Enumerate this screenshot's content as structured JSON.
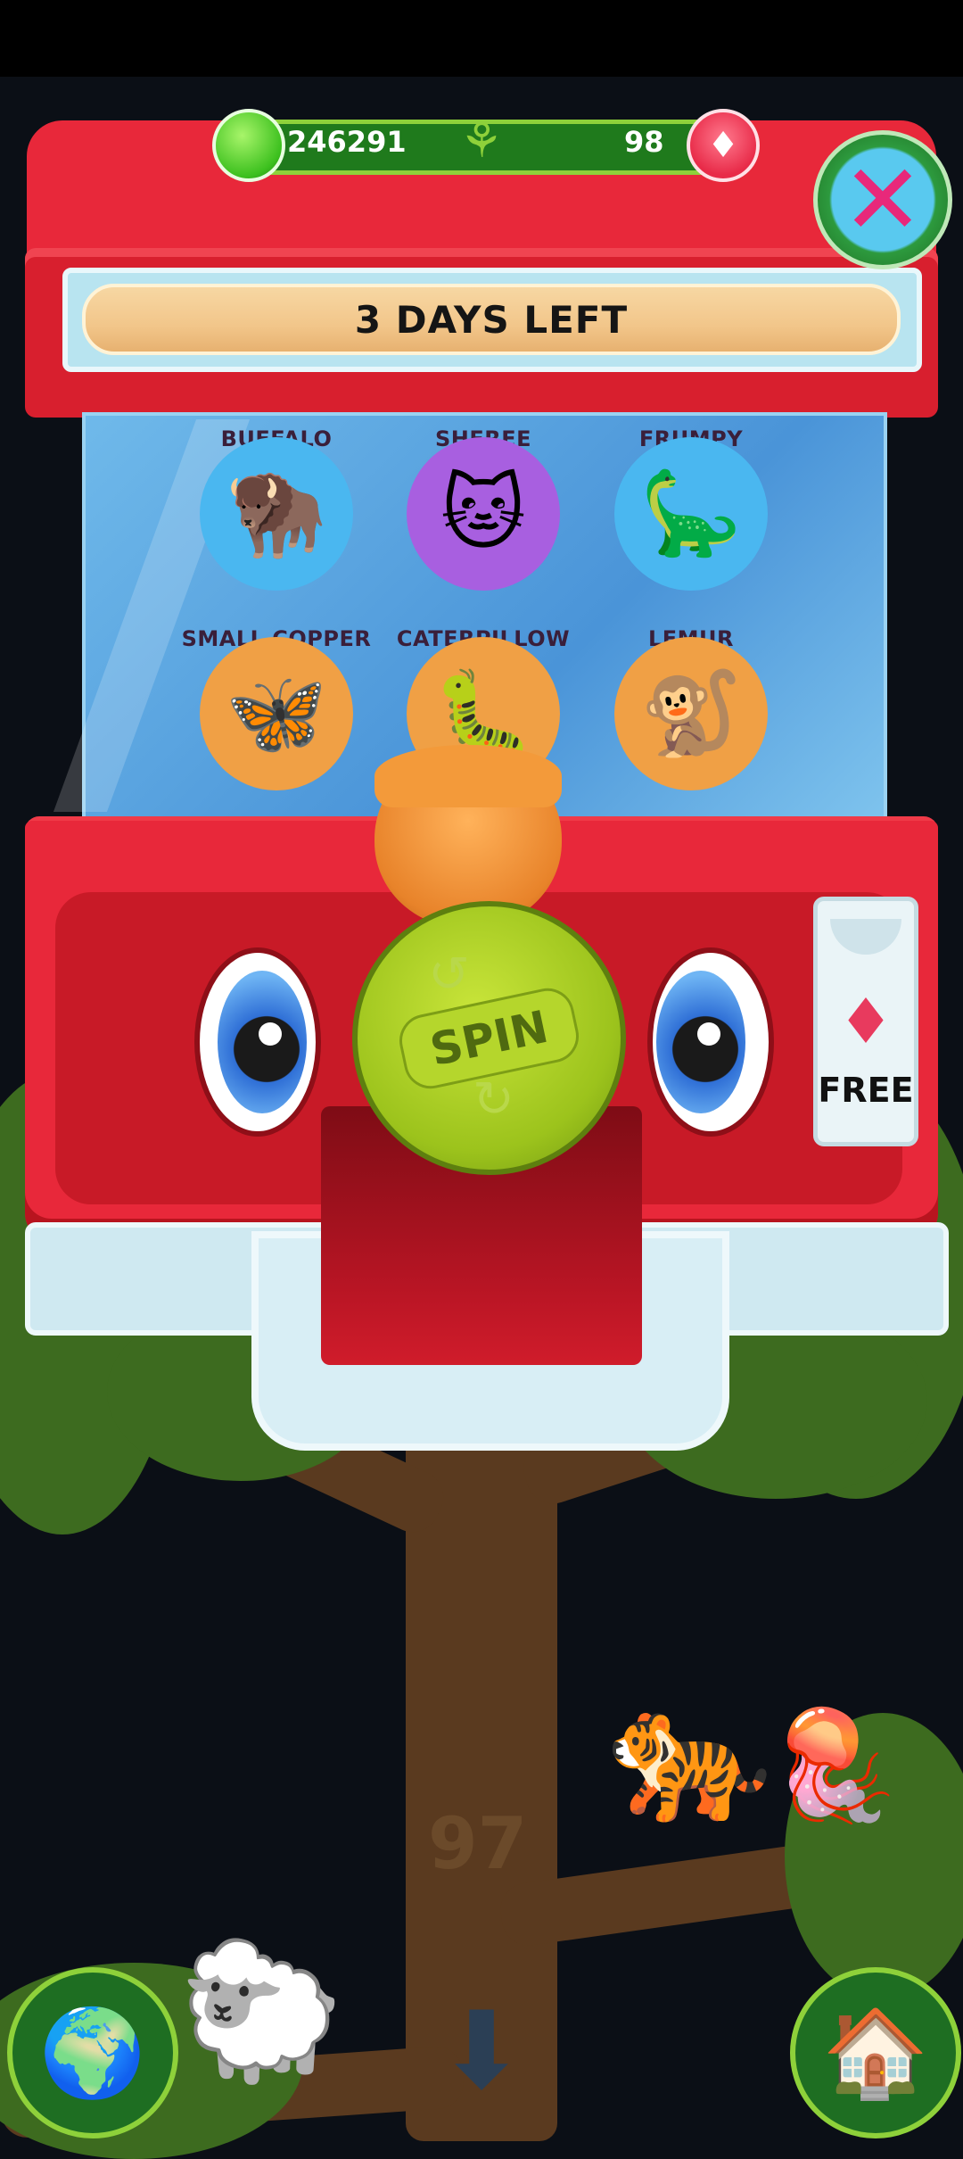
{
  "currency": {
    "coins": "246291",
    "crystals": "98"
  },
  "banner": {
    "text": "3 DAYS LEFT"
  },
  "animals": [
    {
      "name": "BUFFALO",
      "emoji": "🦬",
      "color": "#4ab7f0"
    },
    {
      "name": "SHEREE",
      "emoji": "🐱",
      "color": "#a85fe0"
    },
    {
      "name": "FRUMPY",
      "emoji": "🦕",
      "color": "#4ab7f0"
    },
    {
      "name": "SMALL COPPER",
      "emoji": "🦋",
      "color": "#f0a045"
    },
    {
      "name": "CATERPILLOW",
      "emoji": "🐛",
      "color": "#f0a045"
    },
    {
      "name": "LEMUR",
      "emoji": "🐒",
      "color": "#f0a045"
    }
  ],
  "spin": {
    "label": "SPIN"
  },
  "free": {
    "label": "FREE"
  },
  "tree": {
    "level": "97"
  },
  "icons": {
    "close": "close-icon",
    "globe": "globe-icon",
    "house": "house-icon",
    "down": "down-arrow-icon"
  },
  "colors": {
    "machine": "#e8283a",
    "spin": "#9cc31c",
    "accent_green": "#1f7a1c"
  }
}
